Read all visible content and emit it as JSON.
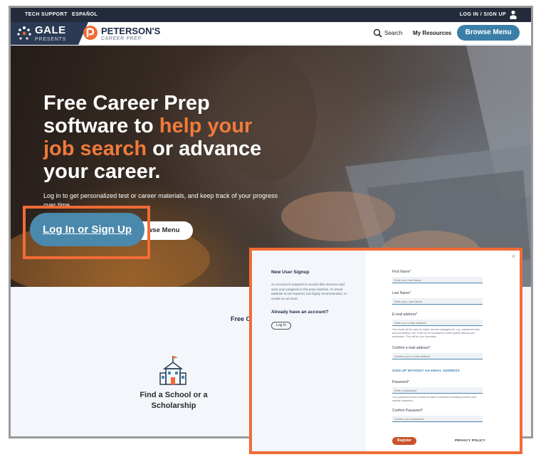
{
  "colors": {
    "accent_orange": "#f26b35",
    "browse_blue": "#3b7fa8",
    "navy": "#242b3a"
  },
  "topbar": {
    "tech_support": "TECH SUPPORT",
    "espanol": "ESPAÑOL",
    "login_signup": "LOG IN / SIGN UP",
    "user_icon": "user-icon"
  },
  "header": {
    "gale": "GALE",
    "gale_presents": "PRESENTS",
    "petersons": "PETERSON'S",
    "career_prep": "CAREER PREP",
    "search_label": "Search",
    "search_icon": "search-icon",
    "my_resources": "My Resources",
    "browse_menu": "Browse Menu"
  },
  "hero": {
    "title_part1": "Free Career Prep software to ",
    "title_highlight1": "help your",
    "title_highlight2": "job search",
    "title_part2": " or advance your career.",
    "subtitle": "Log in to get personalized test or career materials, and keep track of your progress over time.",
    "login_button": "Log In or Sign Up",
    "browse_menu_button": "wse Menu"
  },
  "lower": {
    "free_on": "Free On",
    "school_icon": "school-icon",
    "school_label": "Find a School or a Scholarship"
  },
  "modal": {
    "close": "×",
    "title": "New User Signup",
    "description": "An account is required to access this resource and save your progress in the prep material. An email address is not required, but highly recommended, to create an account.",
    "already": "Already have an account?",
    "login_button": "Log In",
    "fields": {
      "first_name_label": "First Name*",
      "first_name_placeholder": "Enter your first Name",
      "last_name_label": "Last Name*",
      "last_name_placeholder": "Enter your Last Name",
      "email_label": "E-mail address*",
      "email_placeholder": "Enter you e-mail address",
      "email_help": "Your email will be used for easier account management, e.g., password reset, account deletion, etc. It will not be forwarded to other parties without your permission. This will be your username.",
      "confirm_email_label": "Confirm e-mail address*",
      "confirm_email_placeholder": "Confirm your e-mail address",
      "signup_no_email": "SIGN UP WITHOUT AN EMAIL ADDRESS",
      "password_label": "Password*",
      "password_placeholder": "Enter a password",
      "password_help": "Your password should contain at least 8 characters including numbers and special characters.",
      "confirm_password_label": "Confirm Password*",
      "confirm_password_placeholder": "Confirm your password"
    },
    "register_button": "Register",
    "privacy_policy": "PRIVACY POLICY"
  }
}
